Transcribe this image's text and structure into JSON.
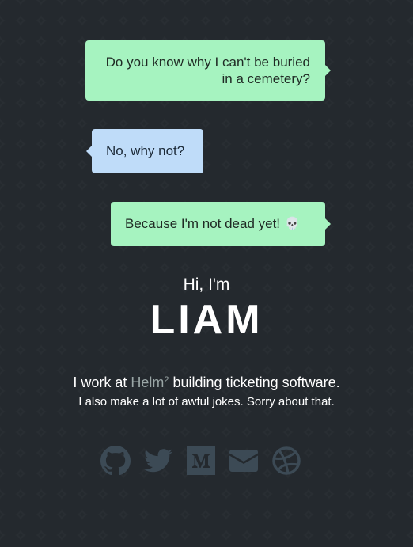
{
  "conversation": {
    "message_1": "Do you know why I can't be buried in a cemetery?",
    "message_2": "No, why not?",
    "message_3": "Because I'm not dead yet!",
    "message_3_emoji": "💀"
  },
  "intro": {
    "greeting": "Hi, I'm",
    "name": "LIAM",
    "work_prefix": "I work at ",
    "company": "Helm",
    "company_sup": "2",
    "work_suffix": " building ticketing software.",
    "jokes": "I also make a lot of awful jokes. Sorry about that."
  },
  "socials": [
    {
      "icon": "github-icon"
    },
    {
      "icon": "twitter-icon"
    },
    {
      "icon": "medium-icon"
    },
    {
      "icon": "email-icon"
    },
    {
      "icon": "dribbble-icon"
    }
  ],
  "colors": {
    "background": "#24292e",
    "bubble_green": "#a6f3c0",
    "bubble_blue": "#bfdcf9",
    "icon_color": "#3c4a55",
    "company_link": "#9aa6a6"
  }
}
